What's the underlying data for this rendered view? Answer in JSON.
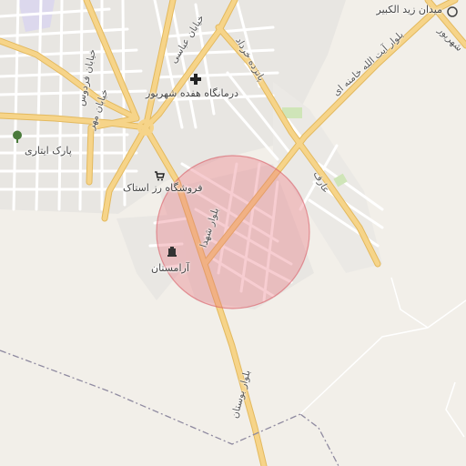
{
  "map": {
    "marker_circle": {
      "fill": "#e8707a",
      "stroke": "#d95c66"
    },
    "colors": {
      "background": "#f2efe9",
      "urban": "#e8e6e2",
      "minor_road": "#ffffff",
      "major_road": "#f6d489",
      "major_road_casing": "#e3b95e",
      "park": "#cfe5b8",
      "boundary": "#8f8aa0"
    },
    "labels": {
      "ziba_square": "میدان زید الکبیر",
      "clinic": "درمانگاه هفده شهریور",
      "park_itari": "پارک ایتاری",
      "store": "فروشگاه رز استاک",
      "cemetery": "آرامستان",
      "boulevard_khamenei": "بلوار آیت الله خامنه ای",
      "boulevard_shohada": "بلوار شهدا",
      "boulevard_bustan": "بلوار بوستان",
      "street_abbasi": "خیابان عباسی",
      "street_ferdows": "خیابان فردوس",
      "street_mehr": "خیابان مهر",
      "street_15khordad": "پانزده خرداد",
      "street_aref": "عارف",
      "street_shahrivar": "شهریور"
    },
    "icons": {
      "clinic": "hospital-cross-icon",
      "park": "tree-icon",
      "store": "shopping-cart-icon",
      "cemetery": "cemetery-icon",
      "square": "town-square-icon"
    }
  }
}
